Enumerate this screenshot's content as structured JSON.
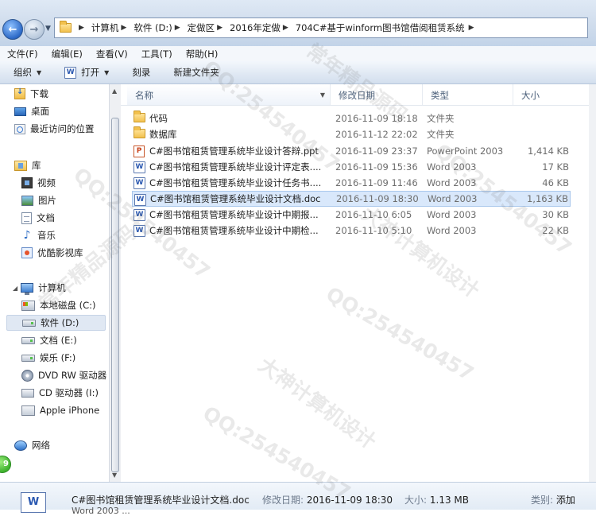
{
  "address": {
    "crumbs": [
      "计算机",
      "软件 (D:)",
      "定做区",
      "2016年定做",
      "704C#基于winform图书馆借阅租赁系统"
    ]
  },
  "menu": [
    "文件(F)",
    "编辑(E)",
    "查看(V)",
    "工具(T)",
    "帮助(H)"
  ],
  "toolbar": {
    "organize": "组织",
    "open": "打开",
    "burn": "刻录",
    "new_folder": "新建文件夹"
  },
  "nav": {
    "favorites": [
      "下载",
      "桌面",
      "最近访问的位置"
    ],
    "library_label": "库",
    "libraries": [
      "视频",
      "图片",
      "文档",
      "音乐",
      "优酷影视库"
    ],
    "computer_label": "计算机",
    "drives": [
      "本地磁盘 (C:)",
      "软件 (D:)",
      "文档 (E:)",
      "娱乐 (F:)",
      "DVD RW 驱动器",
      "CD 驱动器 (I:)",
      "Apple iPhone"
    ],
    "network_label": "网络",
    "badge": "9"
  },
  "columns": {
    "name": "名称",
    "date": "修改日期",
    "type": "类型",
    "size": "大小"
  },
  "files": [
    {
      "name": "代码",
      "date": "2016-11-09 18:18",
      "type": "文件夹",
      "size": "",
      "icon": "folder-icon"
    },
    {
      "name": "数据库",
      "date": "2016-11-12 22:02",
      "type": "文件夹",
      "size": "",
      "icon": "folder-icon"
    },
    {
      "name": "C#图书馆租赁管理系统毕业设计答辩.ppt",
      "date": "2016-11-09 23:37",
      "type": "PowerPoint 2003",
      "size": "1,414 KB",
      "icon": "powerpoint-icon"
    },
    {
      "name": "C#图书馆租赁管理系统毕业设计评定表....",
      "date": "2016-11-09 15:36",
      "type": "Word 2003",
      "size": "17 KB",
      "icon": "word-icon"
    },
    {
      "name": "C#图书馆租赁管理系统毕业设计任务书....",
      "date": "2016-11-09 11:46",
      "type": "Word 2003",
      "size": "46 KB",
      "icon": "word-icon"
    },
    {
      "name": "C#图书馆租赁管理系统毕业设计文档.doc",
      "date": "2016-11-09 18:30",
      "type": "Word 2003",
      "size": "1,163 KB",
      "icon": "word-icon"
    },
    {
      "name": "C#图书馆租赁管理系统毕业设计中期报...",
      "date": "2016-11-10 6:05",
      "type": "Word 2003",
      "size": "30 KB",
      "icon": "word-icon"
    },
    {
      "name": "C#图书馆租赁管理系统毕业设计中期检...",
      "date": "2016-11-10 5:10",
      "type": "Word 2003",
      "size": "22 KB",
      "icon": "word-icon"
    }
  ],
  "details": {
    "name": "C#图书馆租赁管理系统毕业设计文档.doc",
    "date_label": "修改日期:",
    "date": "2016-11-09 18:30",
    "size_label": "大小:",
    "size": "1.13 MB",
    "category_label": "类别:",
    "category": "添加",
    "type_partial": "Word 2003 ..."
  },
  "watermark": {
    "qq": "QQ:254540457",
    "name": "大神计算机设计",
    "src": "常年精品源码"
  }
}
